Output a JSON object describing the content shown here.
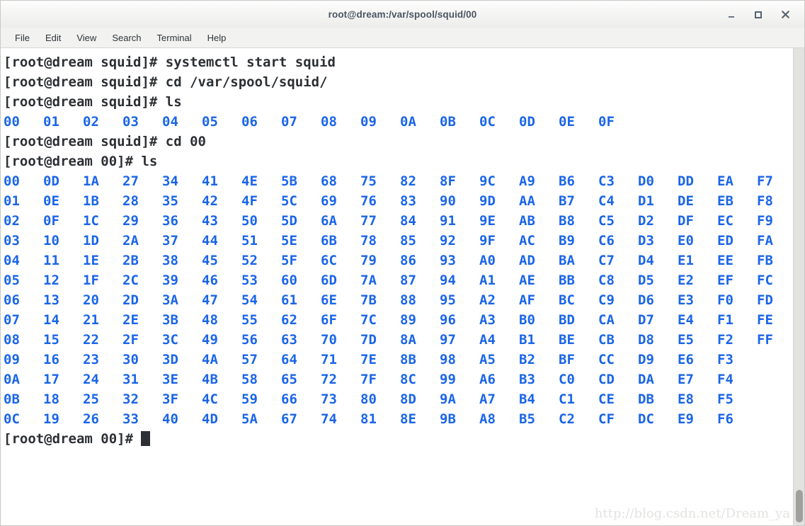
{
  "window": {
    "title": "root@dream:/var/spool/squid/00",
    "controls": [
      {
        "name": "minimize",
        "glyph": "minimize-icon"
      },
      {
        "name": "maximize",
        "glyph": "maximize-icon"
      },
      {
        "name": "close",
        "glyph": "close-icon"
      }
    ]
  },
  "menubar": {
    "items": [
      "File",
      "Edit",
      "View",
      "Search",
      "Terminal",
      "Help"
    ]
  },
  "colors": {
    "terminal_background": "#ffffff",
    "terminal_foreground": "#2c2f33",
    "directory_blue": "#1a65e8",
    "titlebar_text": "#4a5560",
    "watermark": "#e3e3e1",
    "scrollbar_thumb": "#a0a09e"
  },
  "terminal": {
    "lines": [
      {
        "type": "prompt",
        "text": "[root@dream squid]# systemctl start squid"
      },
      {
        "type": "prompt",
        "text": "[root@dream squid]# cd /var/spool/squid/"
      },
      {
        "type": "prompt",
        "text": "[root@dream squid]# ls"
      },
      {
        "type": "listing",
        "id": "ls-squid"
      },
      {
        "type": "prompt",
        "text": "[root@dream squid]# cd 00"
      },
      {
        "type": "prompt",
        "text": "[root@dream 00]# ls"
      },
      {
        "type": "listing",
        "id": "ls-00"
      },
      {
        "type": "prompt-cursor",
        "text": "[root@dream 00]# "
      }
    ],
    "listings": {
      "ls-squid": {
        "columns": 16,
        "rows": 1,
        "order": "column-major",
        "items": [
          "00",
          "01",
          "02",
          "03",
          "04",
          "05",
          "06",
          "07",
          "08",
          "09",
          "0A",
          "0B",
          "0C",
          "0D",
          "0E",
          "0F"
        ]
      },
      "ls-00": {
        "columns": 20,
        "rows": 13,
        "order": "column-major",
        "items": [
          "00",
          "01",
          "02",
          "03",
          "04",
          "05",
          "06",
          "07",
          "08",
          "09",
          "0A",
          "0B",
          "0C",
          "0D",
          "0E",
          "0F",
          "10",
          "11",
          "12",
          "13",
          "14",
          "15",
          "16",
          "17",
          "18",
          "19",
          "1A",
          "1B",
          "1C",
          "1D",
          "1E",
          "1F",
          "20",
          "21",
          "22",
          "23",
          "24",
          "25",
          "26",
          "27",
          "28",
          "29",
          "2A",
          "2B",
          "2C",
          "2D",
          "2E",
          "2F",
          "30",
          "31",
          "32",
          "33",
          "34",
          "35",
          "36",
          "37",
          "38",
          "39",
          "3A",
          "3B",
          "3C",
          "3D",
          "3E",
          "3F",
          "40",
          "41",
          "42",
          "43",
          "44",
          "45",
          "46",
          "47",
          "48",
          "49",
          "4A",
          "4B",
          "4C",
          "4D",
          "4E",
          "4F",
          "50",
          "51",
          "52",
          "53",
          "54",
          "55",
          "56",
          "57",
          "58",
          "59",
          "5A",
          "5B",
          "5C",
          "5D",
          "5E",
          "5F",
          "60",
          "61",
          "62",
          "63",
          "64",
          "65",
          "66",
          "67",
          "68",
          "69",
          "6A",
          "6B",
          "6C",
          "6D",
          "6E",
          "6F",
          "70",
          "71",
          "72",
          "73",
          "74",
          "75",
          "76",
          "77",
          "78",
          "79",
          "7A",
          "7B",
          "7C",
          "7D",
          "7E",
          "7F",
          "80",
          "81",
          "82",
          "83",
          "84",
          "85",
          "86",
          "87",
          "88",
          "89",
          "8A",
          "8B",
          "8C",
          "8D",
          "8E",
          "8F",
          "90",
          "91",
          "92",
          "93",
          "94",
          "95",
          "96",
          "97",
          "98",
          "99",
          "9A",
          "9B",
          "9C",
          "9D",
          "9E",
          "9F",
          "A0",
          "A1",
          "A2",
          "A3",
          "A4",
          "A5",
          "A6",
          "A7",
          "A8",
          "A9",
          "AA",
          "AB",
          "AC",
          "AD",
          "AE",
          "AF",
          "B0",
          "B1",
          "B2",
          "B3",
          "B4",
          "B5",
          "B6",
          "B7",
          "B8",
          "B9",
          "BA",
          "BB",
          "BC",
          "BD",
          "BE",
          "BF",
          "C0",
          "C1",
          "C2",
          "C3",
          "C4",
          "C5",
          "C6",
          "C7",
          "C8",
          "C9",
          "CA",
          "CB",
          "CC",
          "CD",
          "CE",
          "CF",
          "D0",
          "D1",
          "D2",
          "D3",
          "D4",
          "D5",
          "D6",
          "D7",
          "D8",
          "D9",
          "DA",
          "DB",
          "DC",
          "DD",
          "DE",
          "DF",
          "E0",
          "E1",
          "E2",
          "E3",
          "E4",
          "E5",
          "E6",
          "E7",
          "E8",
          "E9",
          "EA",
          "EB",
          "EC",
          "ED",
          "EE",
          "EF",
          "F0",
          "F1",
          "F2",
          "F3",
          "F4",
          "F5",
          "F6",
          "F7",
          "F8",
          "F9",
          "FA",
          "FB",
          "FC",
          "FD",
          "FE",
          "FF"
        ]
      }
    }
  },
  "watermark": {
    "text": "http://blog.csdn.net/Dream_ya"
  },
  "scrollbar": {
    "thumb_position": "bottom"
  }
}
